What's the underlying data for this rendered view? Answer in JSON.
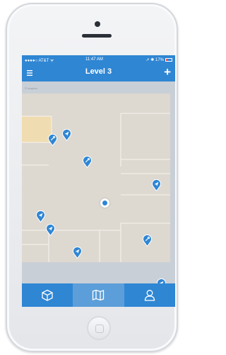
{
  "status_bar": {
    "carrier": "●●●●○ AT&T ᯤ",
    "time": "11:47 AM",
    "battery": "➚ ✱ 17%"
  },
  "nav": {
    "title": "Level 3",
    "menu_icon": "hamburger-menu-icon",
    "add_icon": "plus-icon",
    "add_label": "+"
  },
  "map": {
    "attribution": "© mapbox",
    "user_location": "blue-dot",
    "markers": [
      {
        "icon": "wrench-icon",
        "kind": "pin"
      },
      {
        "icon": "arrow-icon",
        "kind": "pin"
      },
      {
        "icon": "wrench-icon",
        "kind": "pin"
      },
      {
        "icon": "arrow-icon",
        "kind": "pin"
      },
      {
        "icon": "arrow-icon",
        "kind": "pin"
      },
      {
        "icon": "arrow-icon",
        "kind": "pin"
      },
      {
        "icon": "arrow-icon",
        "kind": "pin"
      },
      {
        "icon": "wrench-icon",
        "kind": "pin"
      },
      {
        "icon": "arrow-icon",
        "kind": "pin"
      }
    ]
  },
  "tabs": [
    {
      "icon": "box-icon",
      "active": false
    },
    {
      "icon": "map-icon",
      "active": true
    },
    {
      "icon": "person-icon",
      "active": false
    }
  ],
  "colors": {
    "primary": "#2f86d3",
    "tab_active": "#5b9ed9",
    "map_background": "#c9cfd6",
    "floor": "#ddd8d0",
    "highlight_room": "#efdcb0",
    "marker": "#2f86d3"
  }
}
